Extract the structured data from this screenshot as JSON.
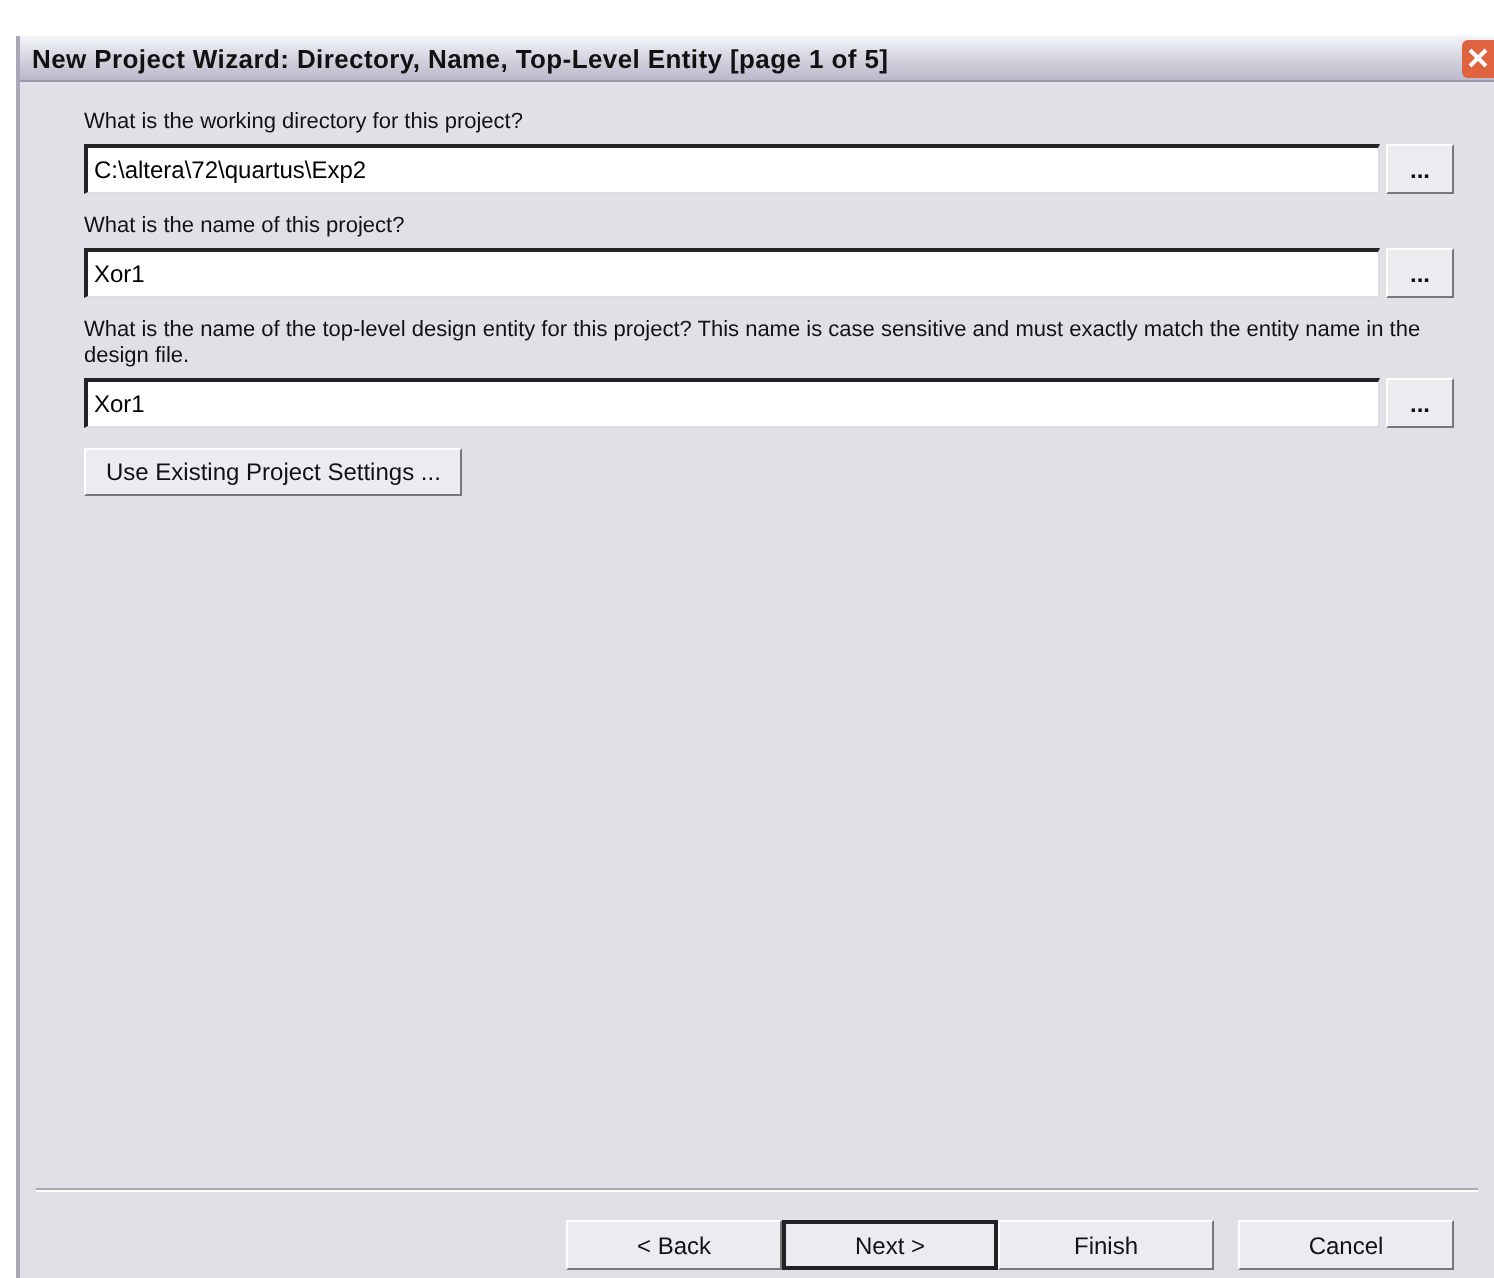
{
  "window": {
    "title": "New Project Wizard: Directory, Name, Top-Level Entity [page 1 of 5]"
  },
  "fields": [
    {
      "label": "What is the working directory for this project?",
      "value": "C:\\altera\\72\\quartus\\Exp2",
      "browse": "..."
    },
    {
      "label": "What is the name of this project?",
      "value": "Xor1",
      "browse": "..."
    },
    {
      "label": "What is the name of the top-level design entity for this project? This name is case sensitive and must exactly match the entity name in the design file.",
      "value": "Xor1",
      "browse": "..."
    }
  ],
  "settings_button": "Use Existing Project Settings ...",
  "buttons": [
    {
      "label": "< Back",
      "default": false
    },
    {
      "label": "Next >",
      "default": true
    },
    {
      "label": "Finish",
      "default": false
    },
    {
      "label": "Cancel",
      "default": false
    }
  ]
}
